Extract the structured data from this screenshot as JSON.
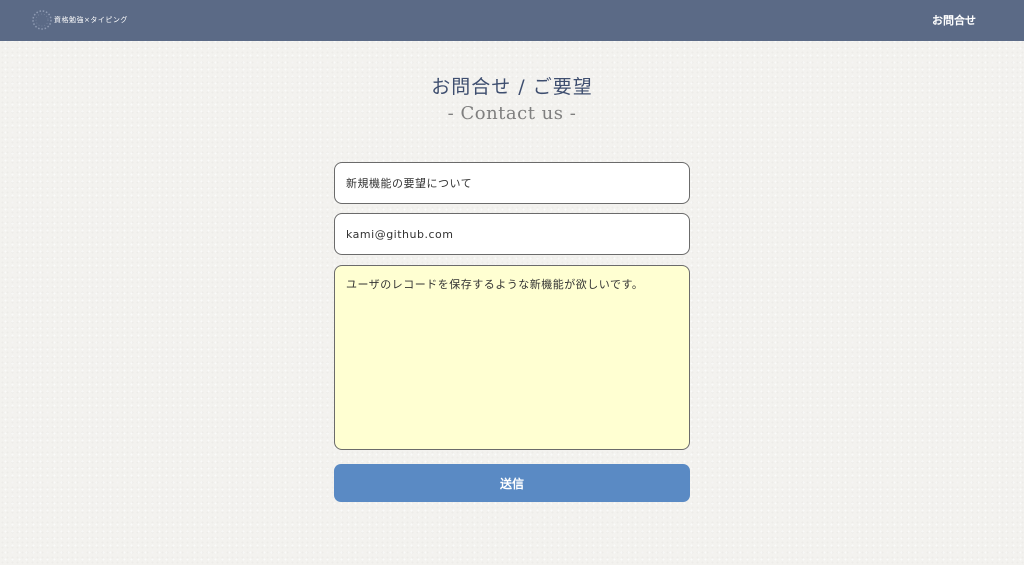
{
  "header": {
    "logo_text": "資格勉強×タイピング",
    "nav_contact": "お問合せ"
  },
  "page": {
    "title": "お問合せ / ご要望",
    "subtitle": "- Contact us -"
  },
  "form": {
    "subject_value": "新規機能の要望について",
    "email_value": "kami@github.com",
    "message_value": "ユーザのレコードを保存するような新機能が欲しいです。",
    "submit_label": "送信"
  },
  "colors": {
    "header_bg": "#5b6a86",
    "title": "#3e4e6f",
    "message_bg": "#ffffd2",
    "button_bg": "#5a8ac4"
  },
  "icons": {
    "logo": "dotted-circle-logo-icon"
  }
}
